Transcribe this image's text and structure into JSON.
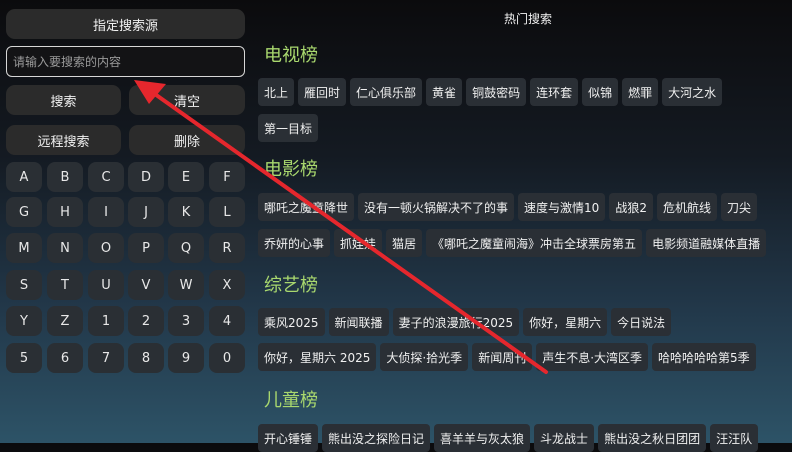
{
  "left": {
    "source_button": "指定搜索源",
    "search_input": {
      "value": "",
      "placeholder": "请输入要搜索的内容"
    },
    "search_button": "搜索",
    "clear_button": "清空",
    "remote_search_button": "远程搜索",
    "delete_button": "删除",
    "keys": [
      [
        "A",
        "B",
        "C",
        "D",
        "E",
        "F"
      ],
      [
        "G",
        "H",
        "I",
        "J",
        "K",
        "L"
      ],
      [
        "M",
        "N",
        "O",
        "P",
        "Q",
        "R"
      ],
      [
        "S",
        "T",
        "U",
        "V",
        "W",
        "X"
      ],
      [
        "Y",
        "Z",
        "1",
        "2",
        "3",
        "4"
      ],
      [
        "5",
        "6",
        "7",
        "8",
        "9",
        "0"
      ]
    ]
  },
  "right": {
    "title": "热门搜索",
    "sections": [
      {
        "title": "电视榜",
        "rows": [
          [
            "北上",
            "雁回时",
            "仁心俱乐部",
            "黄雀",
            "铜鼓密码",
            "连环套",
            "似锦",
            "燃罪",
            "大河之水"
          ],
          [
            "第一目标"
          ]
        ]
      },
      {
        "title": "电影榜",
        "rows": [
          [
            "哪吒之魔童降世",
            "没有一顿火锅解决不了的事",
            "速度与激情10",
            "战狼2",
            "危机航线",
            "刀尖"
          ],
          [
            "乔妍的心事",
            "抓娃娃",
            "猫居",
            "《哪吒之魔童闹海》冲击全球票房第五",
            "电影频道融媒体直播"
          ]
        ]
      },
      {
        "title": "综艺榜",
        "rows": [
          [
            "乘风2025",
            "新闻联播",
            "妻子的浪漫旅行2025",
            "你好，星期六",
            "今日说法"
          ],
          [
            "你好，星期六 2025",
            "大侦探·拾光季",
            "新闻周刊",
            "声生不息·大湾区季",
            "哈哈哈哈哈第5季"
          ]
        ]
      },
      {
        "title": "儿童榜",
        "rows": [
          [
            "开心锤锤",
            "熊出没之探险日记",
            "喜羊羊与灰太狼",
            "斗龙战士",
            "熊出没之秋日团团",
            "汪汪队"
          ]
        ]
      }
    ]
  },
  "colors": {
    "section_title": "#a9d86e",
    "arrow": "#e5272d"
  }
}
